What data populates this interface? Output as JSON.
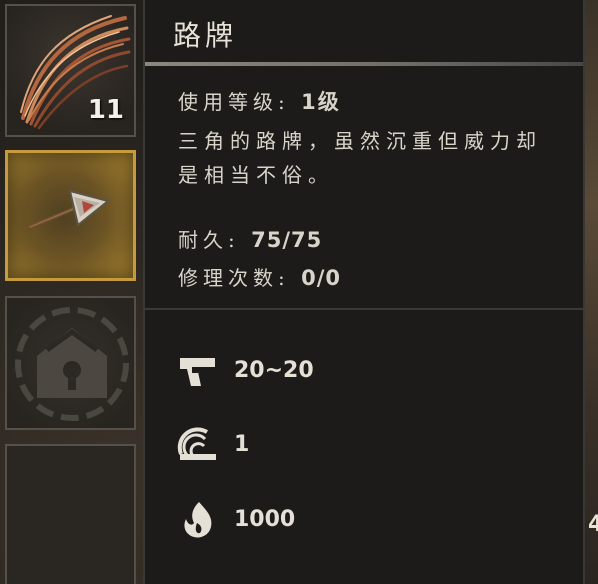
{
  "inventory": {
    "slots": [
      {
        "item_icon": "feather-bundle-icon",
        "count": "11"
      },
      {
        "item_icon": "road-sign-spear-icon",
        "selected": true
      },
      {
        "item_icon": "locked-slot-icon"
      }
    ]
  },
  "tooltip": {
    "title": "路牌",
    "level_label": "使用等级:",
    "level_value": "1级",
    "description": "三角的路牌，虽然沉重但威力却是相当不俗。",
    "durability_label": "耐久:",
    "durability_value": "75/75",
    "repair_label": "修理次数:",
    "repair_value": "0/0",
    "attributes": [
      {
        "icon": "pistol-icon",
        "value": "20~20"
      },
      {
        "icon": "swing-icon",
        "value": "1"
      },
      {
        "icon": "flame-icon",
        "value": "1000"
      }
    ]
  },
  "background": {
    "edge_glyph": "4"
  },
  "colors": {
    "panel": "#1c1b19",
    "selected_border": "#c89a3e",
    "text": "#d8d4ca"
  }
}
